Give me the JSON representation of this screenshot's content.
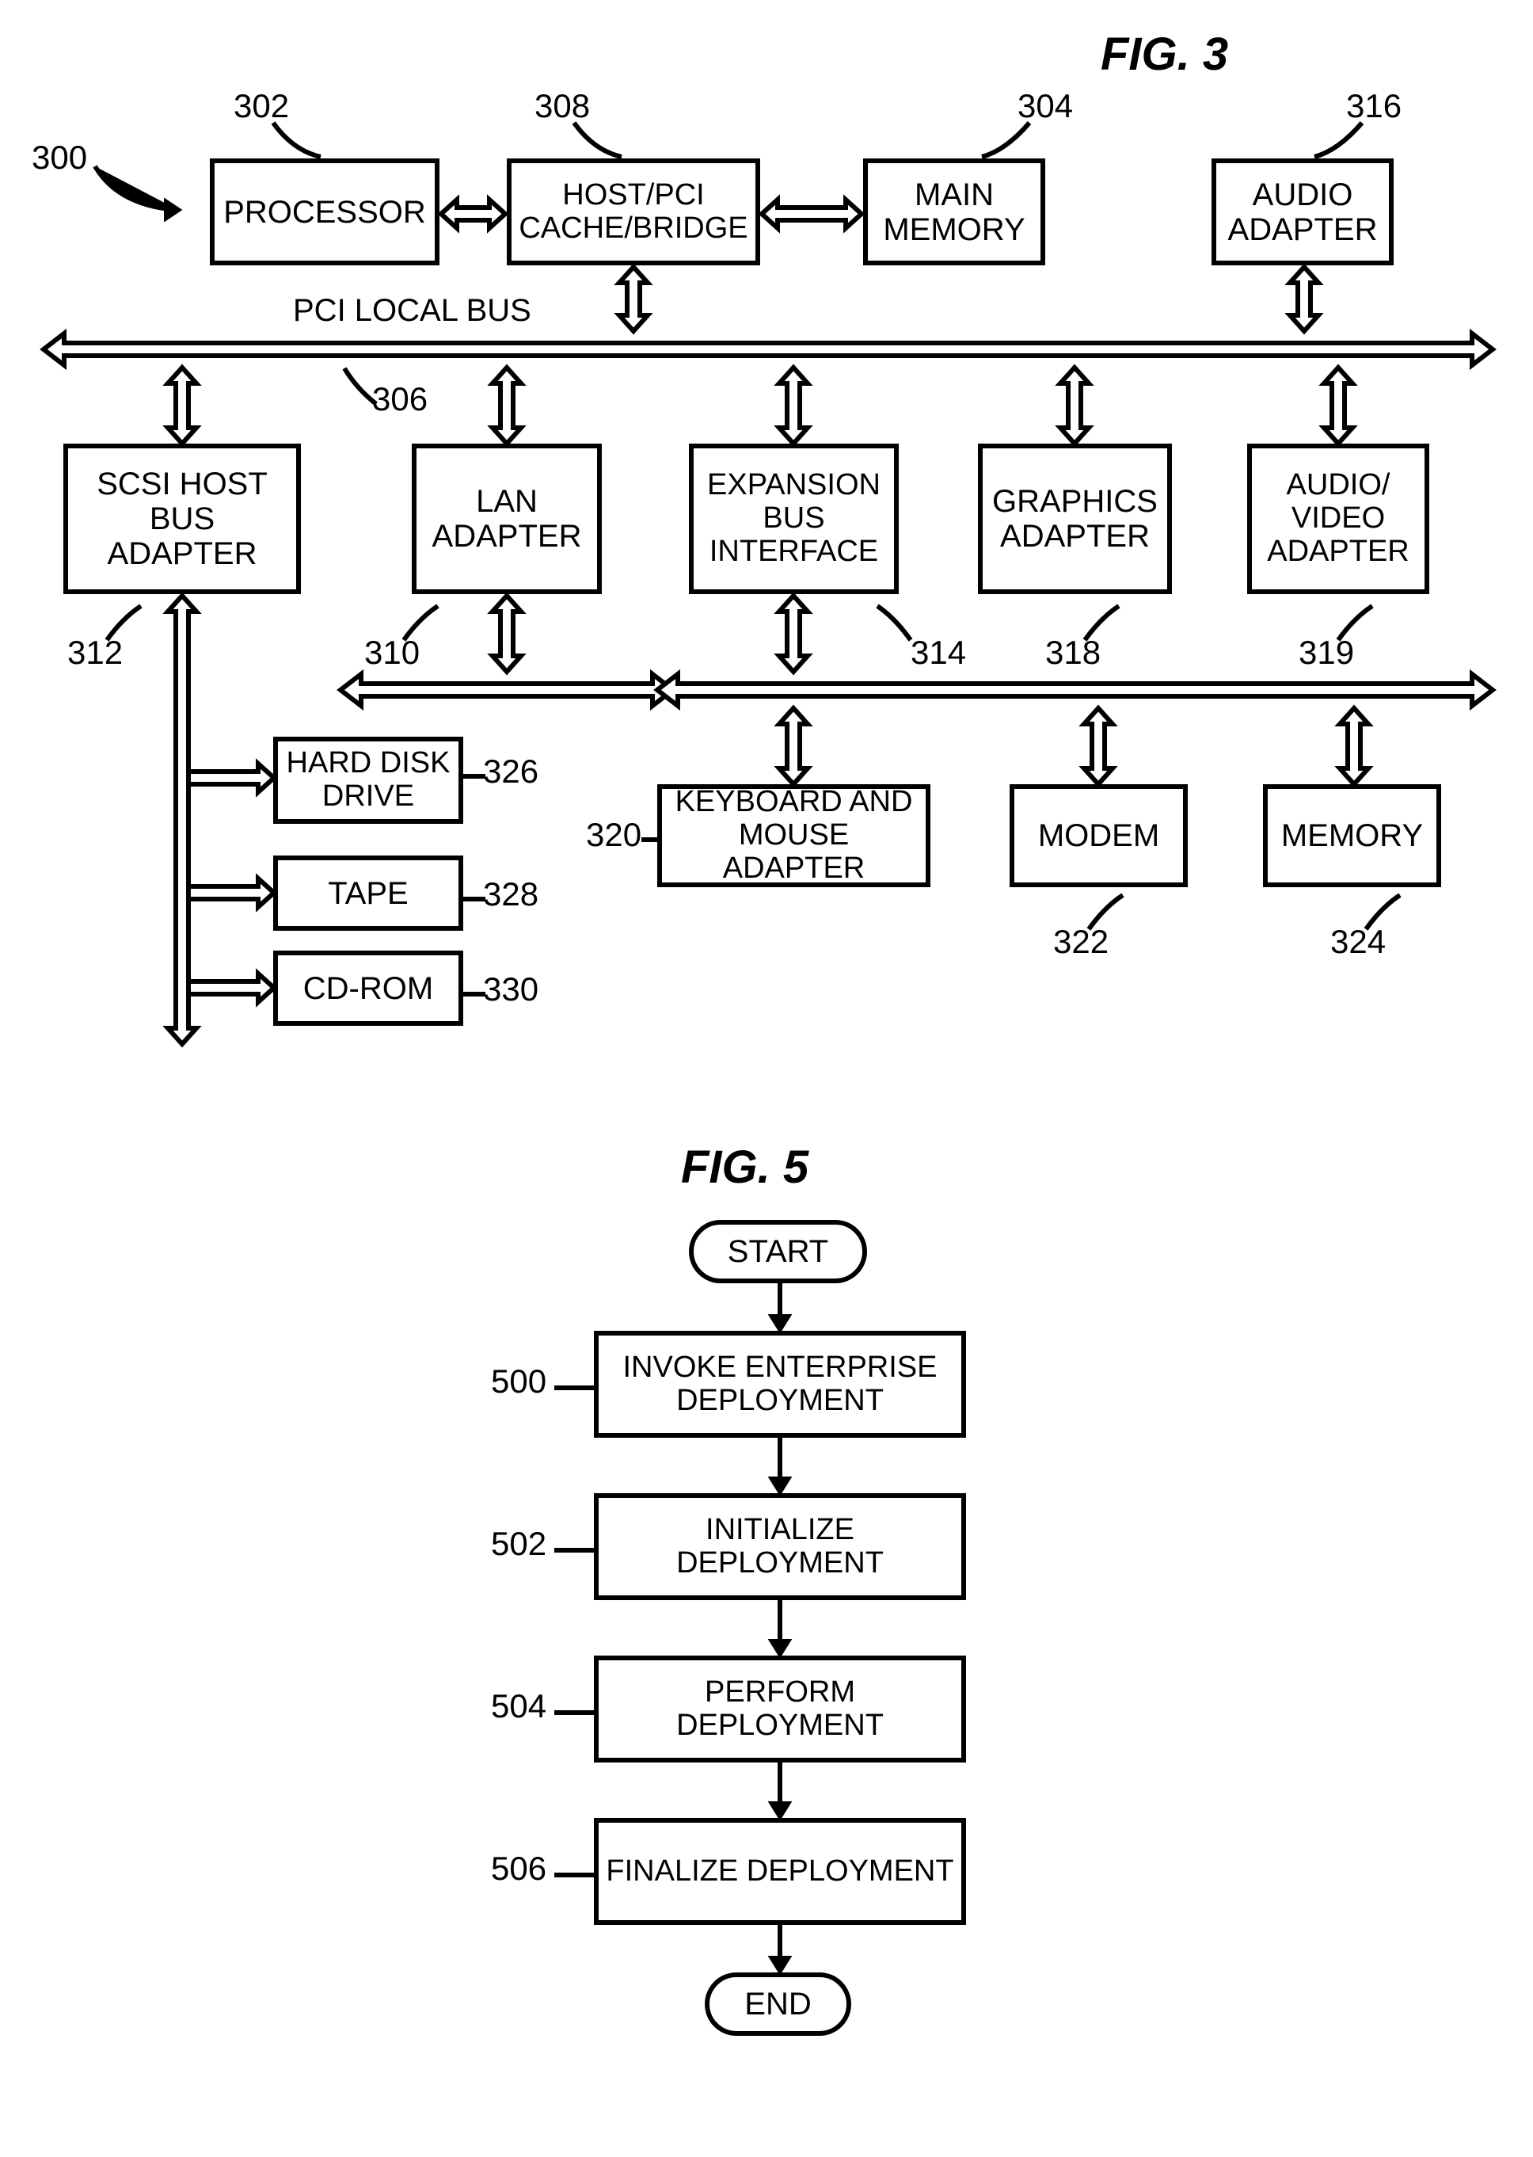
{
  "fig3": {
    "title": "FIG. 3",
    "system_ref": "300",
    "bus_label": "PCI LOCAL BUS",
    "blocks": {
      "processor": {
        "label": "PROCESSOR",
        "ref": "302"
      },
      "host": {
        "label": "HOST/PCI CACHE/BRIDGE",
        "ref": "308"
      },
      "mem": {
        "label": "MAIN MEMORY",
        "ref": "304"
      },
      "audio": {
        "label": "AUDIO ADAPTER",
        "ref": "316"
      },
      "scsi": {
        "label": "SCSI HOST BUS ADAPTER",
        "ref": "312"
      },
      "lan": {
        "label": "LAN ADAPTER",
        "ref": "310"
      },
      "exp": {
        "label": "EXPANSION BUS INTERFACE",
        "ref": "314"
      },
      "gfx": {
        "label": "GRAPHICS ADAPTER",
        "ref": "318"
      },
      "av": {
        "label": "AUDIO/ VIDEO ADAPTER",
        "ref": "319"
      },
      "hdd": {
        "label": "HARD DISK DRIVE",
        "ref": "326"
      },
      "tape": {
        "label": "TAPE",
        "ref": "328"
      },
      "cdrom": {
        "label": "CD-ROM",
        "ref": "330"
      },
      "kbm": {
        "label": "KEYBOARD AND MOUSE ADAPTER",
        "ref": "320"
      },
      "modem": {
        "label": "MODEM",
        "ref": "322"
      },
      "memory2": {
        "label": "MEMORY",
        "ref": "324"
      }
    },
    "bus_ref": "306"
  },
  "fig5": {
    "title": "FIG. 5",
    "start": "START",
    "end": "END",
    "steps": [
      {
        "label": "INVOKE ENTERPRISE DEPLOYMENT",
        "ref": "500"
      },
      {
        "label": "INITIALIZE DEPLOYMENT",
        "ref": "502"
      },
      {
        "label": "PERFORM DEPLOYMENT",
        "ref": "504"
      },
      {
        "label": "FINALIZE DEPLOYMENT",
        "ref": "506"
      }
    ]
  }
}
